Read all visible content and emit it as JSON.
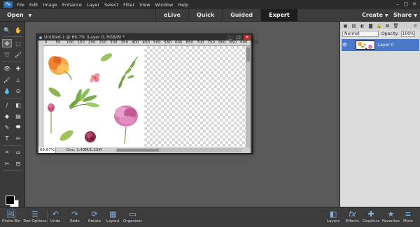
{
  "menubar": {
    "logo": "PSE",
    "items": [
      "File",
      "Edit",
      "Image",
      "Enhance",
      "Layer",
      "Select",
      "Filter",
      "View",
      "Window",
      "Help"
    ],
    "window_controls": [
      "–",
      "□",
      "✕"
    ]
  },
  "topbar": {
    "open_label": "Open",
    "modes": [
      "eLive",
      "Quick",
      "Guided",
      "Expert"
    ],
    "active_mode": "Expert",
    "create_label": "Create",
    "share_label": "Share"
  },
  "document": {
    "title": "Untitled-1 @ 66.7% (Layer 0, RGB/8) *",
    "ruler_ticks": [
      "0",
      "50",
      "100",
      "150",
      "200",
      "250",
      "300",
      "350",
      "400",
      "450",
      "500",
      "550",
      "600",
      "650",
      "700",
      "750",
      "800",
      "850",
      "900",
      "950"
    ],
    "zoom": "66.67%",
    "doc_info": "Doc: 1.43M/1.23M"
  },
  "layers_panel": {
    "blend_mode": "Normal",
    "opacity_label": "Opacity:",
    "opacity_value": "100%",
    "layers": [
      {
        "name": "Layer 0"
      }
    ]
  },
  "bottom_left": [
    "Photo Bin",
    "Tool Options",
    "Undo",
    "Redo",
    "Rotate",
    "Layout",
    "Organizer"
  ],
  "bottom_right": [
    "Layers",
    "Effects",
    "Graphics",
    "Favorites",
    "More"
  ],
  "colors": {
    "accent_blue": "#4a77c8",
    "dark_bg": "#3c3c3c",
    "workspace": "#595959"
  }
}
